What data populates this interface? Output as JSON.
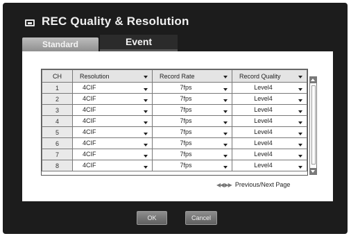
{
  "window": {
    "title": "REC Quality & Resolution"
  },
  "tabs": [
    {
      "label": "Standard",
      "active": false
    },
    {
      "label": "Event",
      "active": true
    }
  ],
  "table": {
    "headers": [
      "CH",
      "Resolution",
      "Record Rate",
      "Record Quality"
    ],
    "rows": [
      {
        "ch": "1",
        "resolution": "4CIF",
        "rate": "7fps",
        "quality": "Level4"
      },
      {
        "ch": "2",
        "resolution": "4CIF",
        "rate": "7fps",
        "quality": "Level4"
      },
      {
        "ch": "3",
        "resolution": "4CIF",
        "rate": "7fps",
        "quality": "Level4"
      },
      {
        "ch": "4",
        "resolution": "4CIF",
        "rate": "7fps",
        "quality": "Level4"
      },
      {
        "ch": "5",
        "resolution": "4CIF",
        "rate": "7fps",
        "quality": "Level4"
      },
      {
        "ch": "6",
        "resolution": "4CIF",
        "rate": "7fps",
        "quality": "Level4"
      },
      {
        "ch": "7",
        "resolution": "4CIF",
        "rate": "7fps",
        "quality": "Level4"
      },
      {
        "ch": "8",
        "resolution": "4CIF",
        "rate": "7fps",
        "quality": "Level4"
      }
    ]
  },
  "pager": {
    "icon": "prev-next-icon",
    "label": "Previous/Next Page"
  },
  "buttons": {
    "ok": "OK",
    "cancel": "Cancel"
  }
}
